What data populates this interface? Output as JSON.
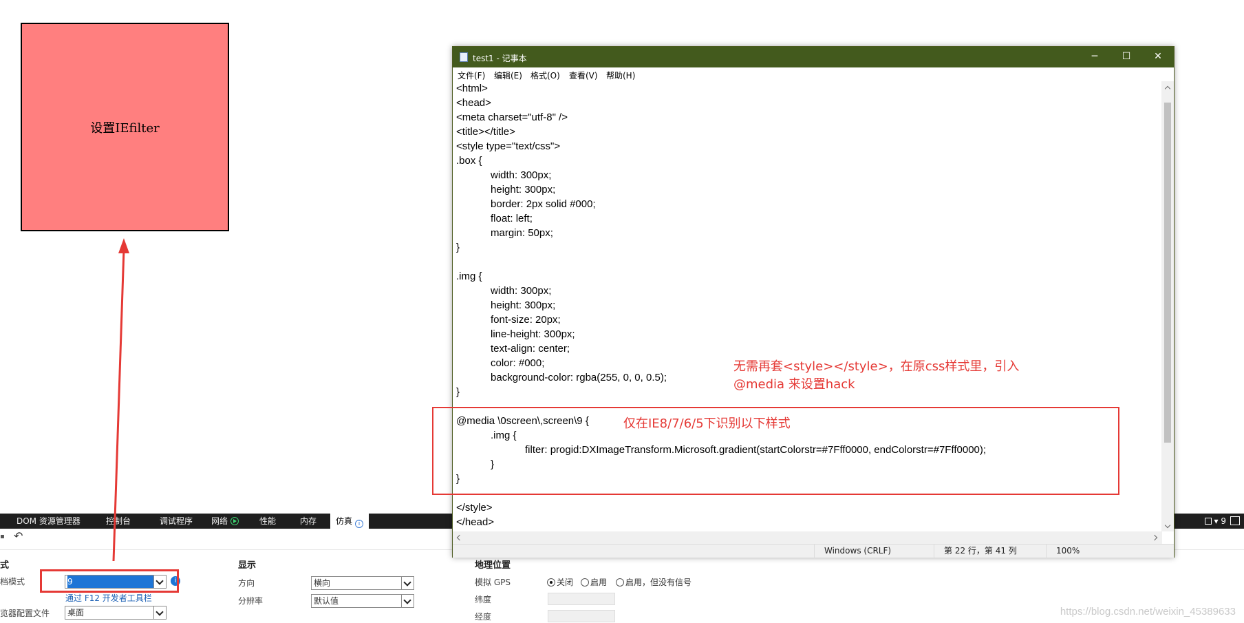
{
  "demo_box": {
    "text": "设置IEfilter",
    "bg_color": "#ff7f7f"
  },
  "devtools": {
    "tabs": [
      "DOM 资源管理器",
      "控制台",
      "调试程序",
      "网络",
      "性能",
      "内存",
      "仿真"
    ],
    "active_tab": "仿真",
    "left_edge_text": "",
    "right_text": "9",
    "bg_color": "#1f1f1f"
  },
  "emulation": {
    "mode_header": "式",
    "doc_mode_label": "档模式",
    "doc_mode_value": "9",
    "doc_mode_link": "通过 F12 开发者工具栏",
    "browser_profile_label": "览器配置文件",
    "browser_profile_value": "桌面",
    "display_header": "显示",
    "orientation_label": "方向",
    "orientation_value": "横向",
    "resolution_label": "分辨率",
    "resolution_value": "默认值",
    "geo_header": "地理位置",
    "gps_label": "模拟 GPS",
    "gps_options": [
      "关闭",
      "启用",
      "启用，但没有信号"
    ],
    "gps_selected": "关闭",
    "latitude_label": "纬度",
    "longitude_label": "经度"
  },
  "notepad": {
    "title": "test1 - 记事本",
    "title_bar_color": "#435a1d",
    "menu": [
      "文件(F)",
      "编辑(E)",
      "格式(O)",
      "查看(V)",
      "帮助(H)"
    ],
    "code_lines": [
      "<html>",
      "<head>",
      "<meta charset=\"utf-8\" />",
      "<title></title>",
      "<style type=\"text/css\">",
      ".box {",
      "            width: 300px;",
      "            height: 300px;",
      "            border: 2px solid #000;",
      "            float: left;",
      "            margin: 50px;",
      "}",
      "",
      ".img {",
      "            width: 300px;",
      "            height: 300px;",
      "            font-size: 20px;",
      "            line-height: 300px;",
      "            text-align: center;",
      "            color: #000;",
      "            background-color: rgba(255, 0, 0, 0.5);",
      "}",
      "",
      "@media \\0screen\\,screen\\9 {",
      "            .img {",
      "                        filter: progid:DXImageTransform.Microsoft.gradient(startColorstr=#7Fff0000, endColorstr=#7Fff0000);",
      "            }",
      "}",
      "",
      "</style>",
      "</head>"
    ],
    "status": {
      "line_ending": "Windows (CRLF)",
      "position": "第 22 行，第 41 列",
      "zoom": "100%"
    }
  },
  "annotations": {
    "note1_line1": "无需再套<style></style>，在原css样式里，引入",
    "note1_line2": "@media 来设置hack",
    "note2": "仅在IE8/7/6/5下识别以下样式",
    "highlight_color": "#e53935"
  },
  "watermark": "https://blog.csdn.net/weixin_45389633"
}
